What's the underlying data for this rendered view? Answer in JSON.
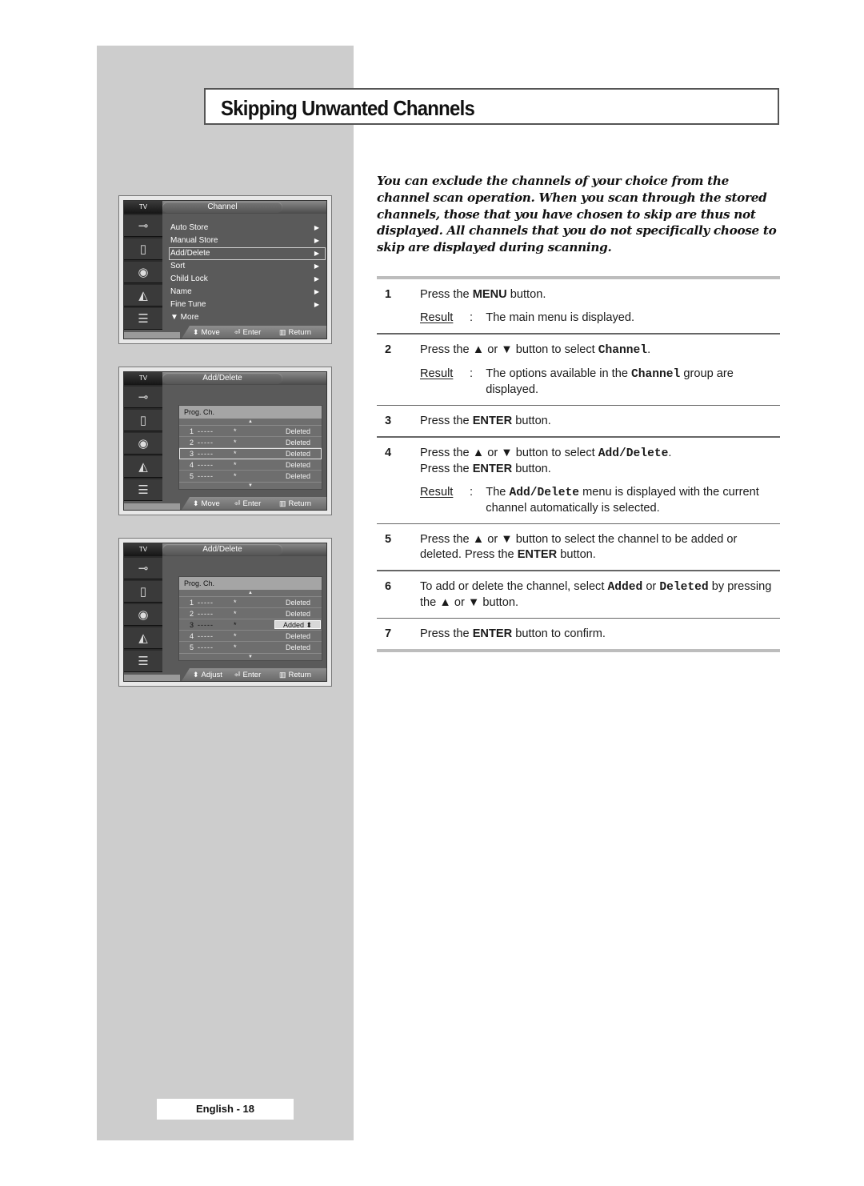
{
  "title": "Skipping Unwanted Channels",
  "intro": "You can exclude the channels of your choice from the channel scan operation. When you scan through the stored channels, those that you have chosen to skip are thus not displayed. All channels that you do not specifically choose to skip are displayed during scanning.",
  "osd_common": {
    "tv_label": "TV",
    "icons": [
      "input-icon",
      "picture-icon",
      "sound-icon",
      "channel-icon",
      "setup-icon"
    ]
  },
  "osd1": {
    "title": "Channel",
    "items": [
      {
        "label": "Auto Store",
        "arrow": "▶"
      },
      {
        "label": "Manual Store",
        "arrow": "▶"
      },
      {
        "label": "Add/Delete",
        "arrow": "▶",
        "selected": true
      },
      {
        "label": "Sort",
        "arrow": "▶"
      },
      {
        "label": "Child Lock",
        "arrow": "▶"
      },
      {
        "label": "Name",
        "arrow": "▶"
      },
      {
        "label": "Fine Tune",
        "arrow": "▶"
      },
      {
        "label": "▼  More",
        "arrow": ""
      }
    ],
    "hints": {
      "move": "Move",
      "enter": "Enter",
      "return": "Return"
    }
  },
  "osd2": {
    "title": "Add/Delete",
    "table_header": "Prog.  Ch.",
    "rows": [
      {
        "num": "1",
        "ch": "-----",
        "star": "*",
        "status": "Deleted"
      },
      {
        "num": "2",
        "ch": "-----",
        "star": "*",
        "status": "Deleted"
      },
      {
        "num": "3",
        "ch": "-----",
        "star": "*",
        "status": "Deleted"
      },
      {
        "num": "4",
        "ch": "-----",
        "star": "*",
        "status": "Deleted"
      },
      {
        "num": "5",
        "ch": "-----",
        "star": "*",
        "status": "Deleted"
      }
    ],
    "hints": {
      "move": "Move",
      "enter": "Enter",
      "return": "Return"
    }
  },
  "osd3": {
    "title": "Add/Delete",
    "table_header": "Prog.  Ch.",
    "rows": [
      {
        "num": "1",
        "ch": "-----",
        "star": "*",
        "status": "Deleted"
      },
      {
        "num": "2",
        "ch": "-----",
        "star": "*",
        "status": "Deleted"
      },
      {
        "num": "3",
        "ch": "-----",
        "star": "*",
        "status": "Added"
      },
      {
        "num": "4",
        "ch": "-----",
        "star": "*",
        "status": "Deleted"
      },
      {
        "num": "5",
        "ch": "-----",
        "star": "*",
        "status": "Deleted"
      }
    ],
    "hints": {
      "move": "Adjust",
      "enter": "Enter",
      "return": "Return"
    }
  },
  "steps": {
    "result_label": "Result",
    "s1": {
      "n": "1",
      "a": "Press the ",
      "b": "MENU",
      "c": " button.",
      "result": "The main menu is displayed."
    },
    "s2": {
      "n": "2",
      "a": "Press the ▲ or ▼ button to select ",
      "code": "Channel",
      "c": ".",
      "r_a": "The options available in the ",
      "r_code": "Channel",
      "r_c": " group are displayed."
    },
    "s3": {
      "n": "3",
      "a": "Press the ",
      "b": "ENTER",
      "c": " button."
    },
    "s4": {
      "n": "4",
      "a": "Press the ▲ or ▼ button to select ",
      "code": "Add/Delete",
      "c": ".",
      "a2": "Press the ",
      "b2": "ENTER",
      "c2": " button.",
      "r_a": "The ",
      "r_code": "Add/Delete",
      "r_c": " menu is displayed with the current channel automatically is selected."
    },
    "s5": {
      "n": "5",
      "a": "Press the ▲ or ▼ button to select the channel to be added or deleted. Press the ",
      "b": "ENTER",
      "c": " button."
    },
    "s6": {
      "n": "6",
      "a": "To add or delete the channel, select ",
      "code1": "Added",
      "mid": " or ",
      "code2": "Deleted",
      "c": " by pressing the ▲ or ▼ button."
    },
    "s7": {
      "n": "7",
      "a": "Press the ",
      "b": "ENTER",
      "c": " button to confirm."
    }
  },
  "footer": "English - 18"
}
